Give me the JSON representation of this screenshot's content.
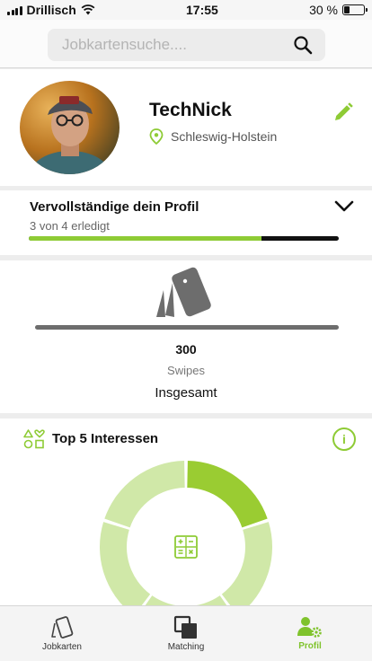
{
  "status_bar": {
    "carrier": "Drillisch",
    "time": "17:55",
    "battery_text": "30 %",
    "battery_level": 0.3
  },
  "search": {
    "placeholder": "Jobkartensuche....",
    "value": ""
  },
  "profile": {
    "name": "TechNick",
    "location": "Schleswig-Holstein"
  },
  "progress": {
    "title": "Vervollständige dein Profil",
    "subtitle": "3 von 4 erledigt",
    "done": 3,
    "total": 4
  },
  "swipes": {
    "count": "300",
    "label": "Swipes",
    "total_label": "Insgesamt"
  },
  "interests": {
    "title": "Top 5 Interessen",
    "info_icon": "i",
    "segments": [
      {
        "share": 0.2,
        "color": "#9acc32"
      },
      {
        "share": 0.2,
        "color": "#d0e8a8"
      },
      {
        "share": 0.2,
        "color": "#d0e8a8"
      },
      {
        "share": 0.2,
        "color": "#d0e8a8"
      },
      {
        "share": 0.2,
        "color": "#d0e8a8"
      }
    ]
  },
  "tabbar": {
    "tabs": [
      {
        "label": "Jobkarten",
        "icon": "card-icon"
      },
      {
        "label": "Matching",
        "icon": "matching-icon"
      },
      {
        "label": "Profil",
        "icon": "profile-gear-icon",
        "active": true
      }
    ]
  },
  "colors": {
    "accent": "#8ecb35",
    "accent_light": "#d0e8a8",
    "dark": "#111111",
    "gray_bar": "#6d6d6d"
  }
}
